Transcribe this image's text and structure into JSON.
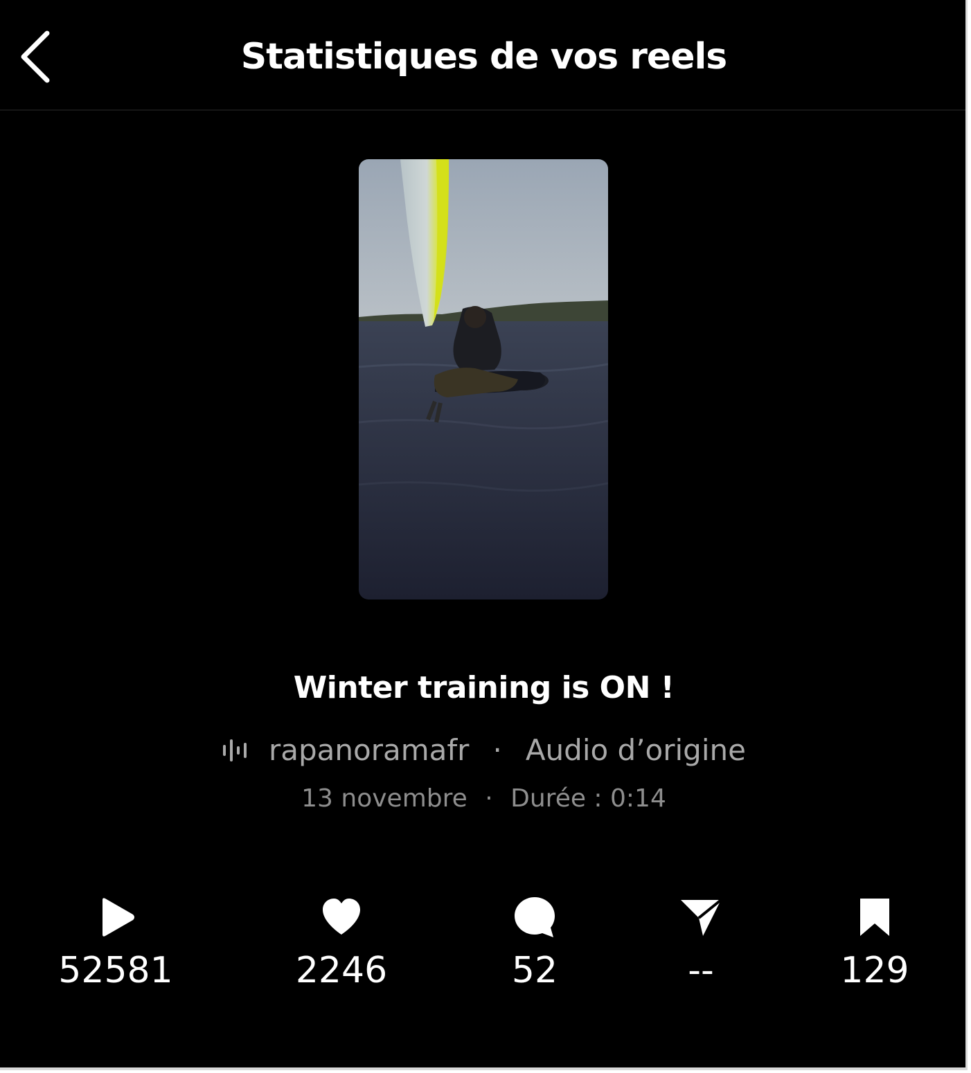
{
  "header": {
    "back_icon": "chevron-left-icon",
    "title": "Statistiques de vos reels"
  },
  "reel": {
    "thumbnail_description_icon": "video-thumbnail",
    "caption": "Winter training is ON !",
    "audio": {
      "icon": "audio-waveform-icon",
      "account": "rapanoramafr",
      "separator": "·",
      "label": "Audio d’origine"
    },
    "meta": {
      "date": "13 novembre",
      "separator": "·",
      "duration": "Durée : 0:14"
    }
  },
  "stats": [
    {
      "icon": "play-icon",
      "value": "52581"
    },
    {
      "icon": "heart-icon",
      "value": "2246"
    },
    {
      "icon": "comment-icon",
      "value": "52"
    },
    {
      "icon": "share-icon",
      "value": "--"
    },
    {
      "icon": "bookmark-icon",
      "value": "129"
    }
  ],
  "colors": {
    "background": "#000000",
    "text_primary": "#ffffff",
    "text_secondary": "#a9a9a9",
    "text_tertiary": "#8e8e8e"
  }
}
